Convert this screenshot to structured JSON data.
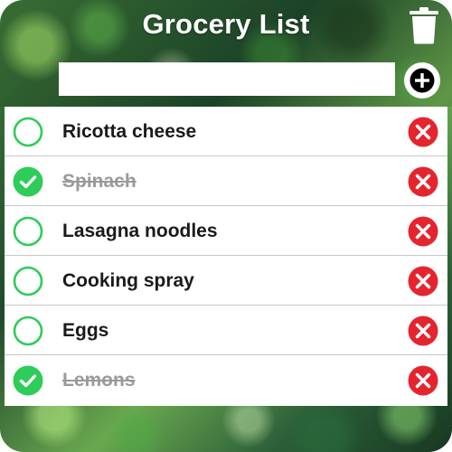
{
  "app": {
    "title": "Grocery List"
  },
  "new_item": {
    "value": "",
    "placeholder": ""
  },
  "colors": {
    "check_green": "#2ecc59",
    "delete_red": "#e5252e",
    "done_text": "#9a9a9a"
  },
  "icons": {
    "trash": "trash-icon",
    "add": "plus-circle-icon",
    "unchecked": "empty-circle-icon",
    "checked": "check-circle-icon",
    "delete": "x-circle-icon"
  },
  "items": [
    {
      "label": "Ricotta cheese",
      "done": false
    },
    {
      "label": "Spinach",
      "done": true
    },
    {
      "label": "Lasagna noodles",
      "done": false
    },
    {
      "label": "Cooking spray",
      "done": false
    },
    {
      "label": "Eggs",
      "done": false
    },
    {
      "label": "Lemons",
      "done": true
    }
  ]
}
